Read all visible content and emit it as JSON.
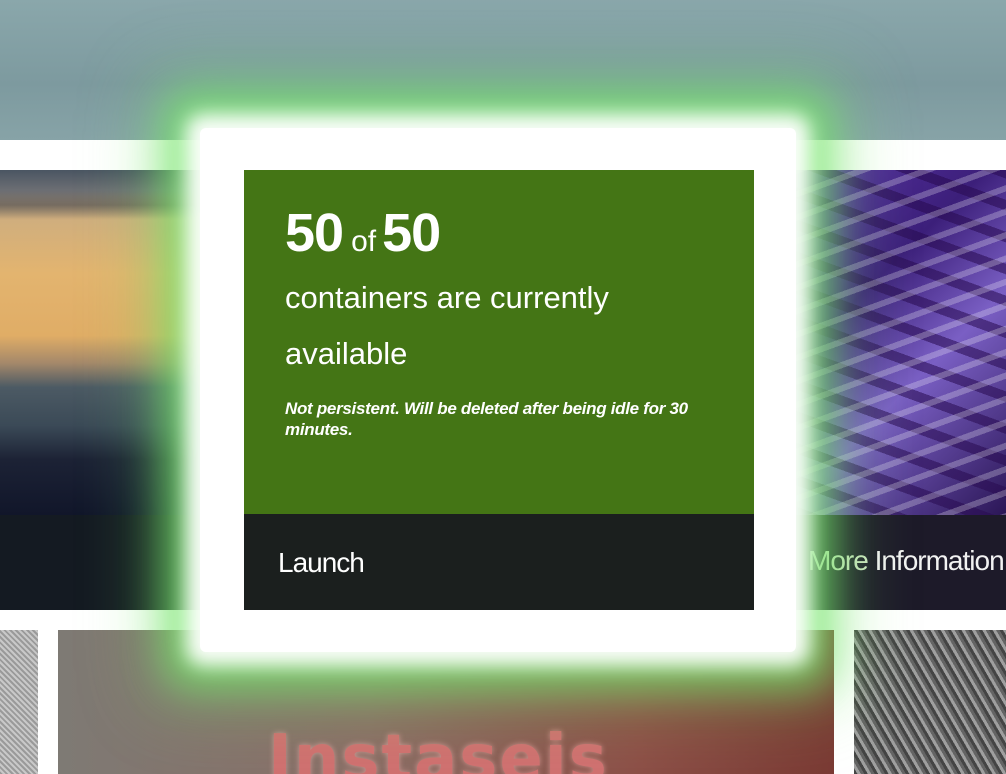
{
  "card": {
    "available_count": "50",
    "of_label": "of",
    "total_count": "50",
    "description": "containers are currently available",
    "note": "Not persistent. Will be deleted after being idle for 30 minutes.",
    "launch_label": "Launch",
    "accent_color": "#447515",
    "footer_color": "#1b1f1e"
  },
  "right_tile": {
    "more_info_first": "More",
    "more_info_rest": " Information"
  },
  "bottom_tile": {
    "logo_text": "Instaseis"
  }
}
